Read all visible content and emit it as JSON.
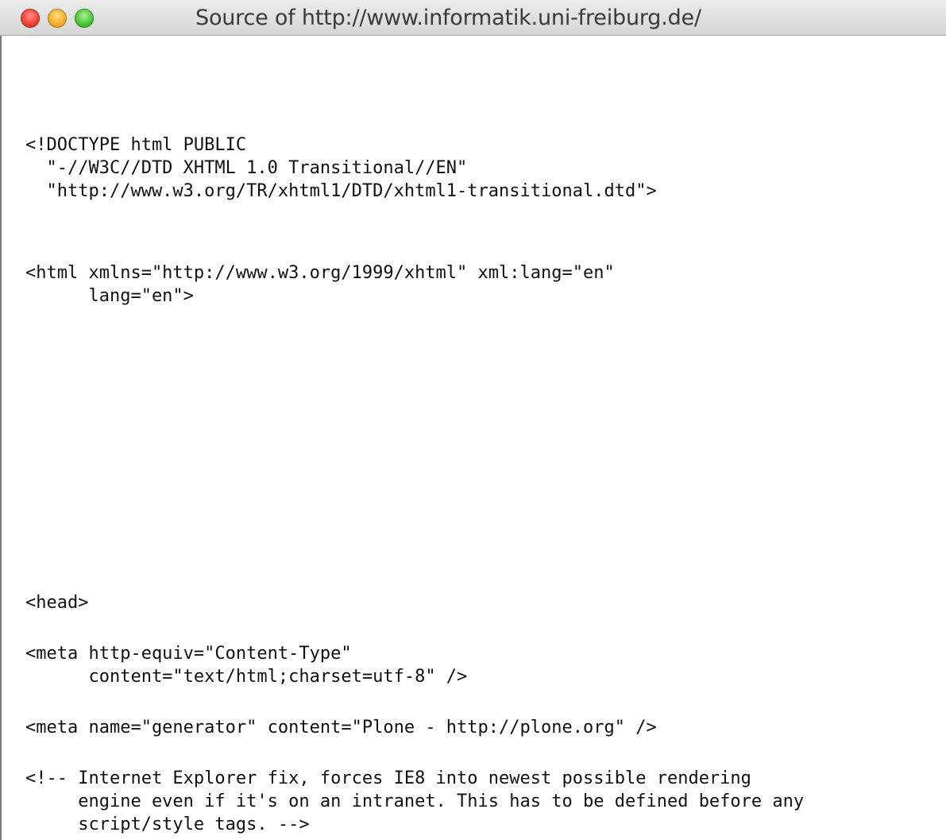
{
  "window": {
    "title": "Source of http://www.informatik.uni-freiburg.de/"
  },
  "source_lines": [
    "<!DOCTYPE html PUBLIC",
    "  \"-//W3C//DTD XHTML 1.0 Transitional//EN\"",
    "  \"http://www.w3.org/TR/xhtml1/DTD/xhtml1-transitional.dtd\">",
    "<html xmlns=\"http://www.w3.org/1999/xhtml\" xml:lang=\"en\"",
    "      lang=\"en\">",
    "<head>",
    "<meta http-equiv=\"Content-Type\"",
    "      content=\"text/html;charset=utf-8\" />",
    "<meta name=\"generator\" content=\"Plone - http://plone.org\" />",
    "<!-- Internet Explorer fix, forces IE8 into newest possible rendering",
    "     engine even if it's on an intranet. This has to be defined before any",
    "     script/style tags. -->"
  ]
}
